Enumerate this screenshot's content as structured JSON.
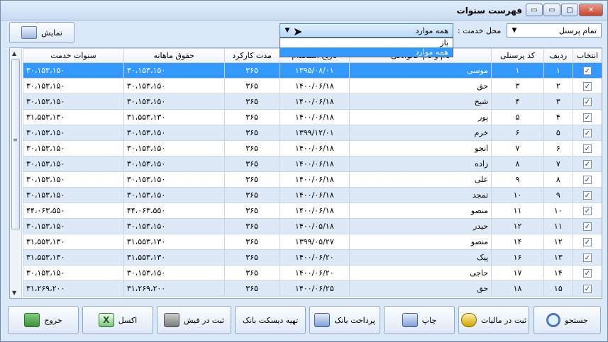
{
  "window": {
    "title": "فهرست سنوات"
  },
  "toolbar": {
    "show_label": "نمایش",
    "staff_select": "تمام پرسنل",
    "place_label": "محل خدمت :",
    "place_select": "همه موارد",
    "dropdown_items": [
      "باز",
      "همه موارد"
    ]
  },
  "table": {
    "headers": [
      "انتخاب",
      "ردیف",
      "کد پرسنلی",
      "نام و نام خانوادگی",
      "تاریخ استخدام",
      "مدت کارکرد",
      "حقوق ماهانه",
      "سنوات خدمت"
    ],
    "rows": [
      {
        "row": "۱",
        "code": "۱",
        "name": "موسی",
        "date": "۱۳۹۵/۰۸/۰۱",
        "days": "۳۶۵",
        "salary": "۳۰،۱۵۳،۱۵۰",
        "severance": "۳۰،۱۵۳،۱۵۰"
      },
      {
        "row": "۲",
        "code": "۳",
        "name": "حق",
        "date": "۱۴۰۰/۰۶/۱۸",
        "days": "۳۶۵",
        "salary": "۳۰،۱۵۳،۱۵۰",
        "severance": "۳۰،۱۵۳،۱۵۰"
      },
      {
        "row": "۳",
        "code": "۴",
        "name": "شیخ",
        "date": "۱۴۰۰/۰۶/۱۸",
        "days": "۳۶۵",
        "salary": "۳۰،۱۵۳،۱۵۰",
        "severance": "۳۰،۱۵۳،۱۵۰"
      },
      {
        "row": "۴",
        "code": "۵",
        "name": "پور",
        "date": "۱۴۰۰/۰۶/۱۸",
        "days": "۳۶۵",
        "salary": "۳۱،۵۵۳،۱۳۰",
        "severance": "۳۱،۵۵۳،۱۳۰"
      },
      {
        "row": "۵",
        "code": "۶",
        "name": "خرم",
        "date": "۱۳۹۹/۱۲/۰۱",
        "days": "۳۶۵",
        "salary": "۳۰،۱۵۳،۱۵۰",
        "severance": "۳۰،۱۵۳،۱۵۰"
      },
      {
        "row": "۶",
        "code": "۷",
        "name": "انجو",
        "date": "۱۴۰۰/۰۶/۱۸",
        "days": "۳۶۵",
        "salary": "۳۰،۱۵۳،۱۵۰",
        "severance": "۳۰،۱۵۳،۱۵۰"
      },
      {
        "row": "۷",
        "code": "۸",
        "name": "زاده",
        "date": "۱۴۰۰/۰۶/۱۸",
        "days": "۳۶۵",
        "salary": "۳۰،۱۵۳،۱۵۰",
        "severance": "۳۰،۱۵۳،۱۵۰"
      },
      {
        "row": "۸",
        "code": "۹",
        "name": "علی",
        "date": "۱۴۰۰/۰۶/۱۸",
        "days": "۳۶۵",
        "salary": "۳۰،۱۵۳،۱۵۰",
        "severance": "۳۰،۱۵۳،۱۵۰"
      },
      {
        "row": "۹",
        "code": "۱۰",
        "name": "تمجد",
        "date": "۱۴۰۰/۰۶/۱۸",
        "days": "۳۶۵",
        "salary": "۳۰،۱۵۳،۱۵۰",
        "severance": "۳۰،۱۵۳،۱۵۰"
      },
      {
        "row": "۱۰",
        "code": "۱۱",
        "name": "منصو",
        "date": "۱۴۰۰/۰۶/۱۸",
        "days": "۳۶۵",
        "salary": "۴۴،۰۶۳،۵۵۰",
        "severance": "۴۴،۰۶۳،۵۵۰"
      },
      {
        "row": "۱۱",
        "code": "۱۲",
        "name": "حیدر",
        "date": "۱۴۰۰/۰۵/۱۸",
        "days": "۳۶۵",
        "salary": "۳۰،۱۵۳،۱۵۰",
        "severance": "۳۰،۱۵۳،۱۵۰"
      },
      {
        "row": "۱۲",
        "code": "۱۴",
        "name": "منصو",
        "date": "۱۳۹۹/۰۵/۲۷",
        "days": "۳۶۵",
        "salary": "۳۱،۵۵۳،۱۳۰",
        "severance": "۳۱،۵۵۳،۱۳۰"
      },
      {
        "row": "۱۳",
        "code": "۱۶",
        "name": "پیک",
        "date": "۱۴۰۰/۰۶/۲۰",
        "days": "۳۶۵",
        "salary": "۳۱،۵۵۳،۱۳۰",
        "severance": "۳۱،۵۵۳،۱۳۰"
      },
      {
        "row": "۱۴",
        "code": "۱۷",
        "name": "حاجی",
        "date": "۱۴۰۰/۰۶/۲۰",
        "days": "۳۶۵",
        "salary": "۳۰،۱۵۳،۱۵۰",
        "severance": "۳۰،۱۵۳،۱۵۰"
      },
      {
        "row": "۱۵",
        "code": "۱۸",
        "name": "حق",
        "date": "۱۴۰۰/۰۶/۲۵",
        "days": "۳۶۵",
        "salary": "۳۱،۲۶۹،۲۰۰",
        "severance": "۳۱،۲۶۹،۲۰۰"
      }
    ]
  },
  "buttons": {
    "search": "جستجو",
    "tax": "ثبت در مالیات",
    "print": "چاپ",
    "bank_pay": "پرداخت بانک",
    "bank_disk": "تهیه دیسکت بانک",
    "receipt": "ثبت در فیش",
    "excel": "اکسل",
    "exit": "خروج"
  },
  "icons": {
    "excel": "X"
  }
}
